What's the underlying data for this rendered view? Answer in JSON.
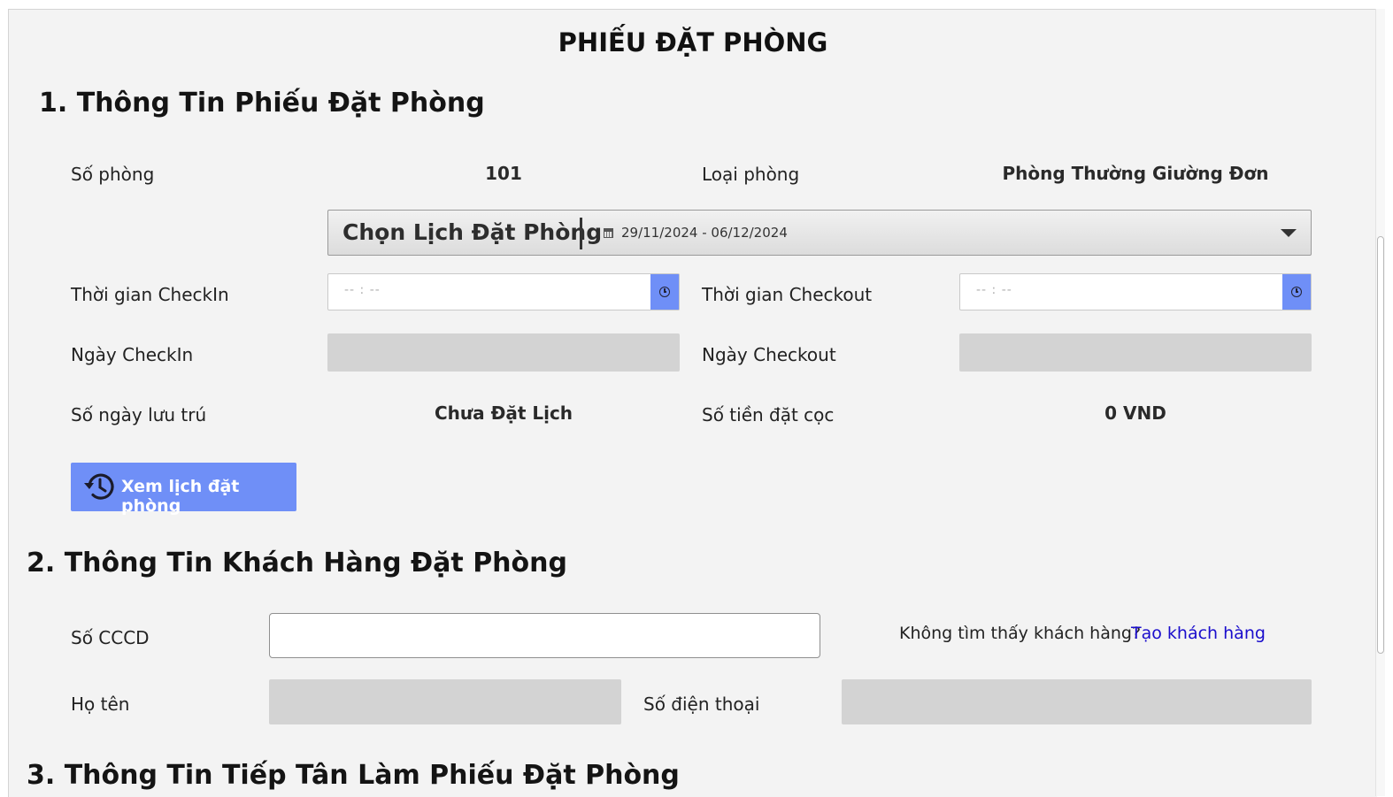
{
  "title": "PHIẾU ĐẶT PHÒNG",
  "section1": {
    "title": "1. Thông Tin Phiếu Đặt Phòng",
    "room_number_label": "Số phòng",
    "room_number_value": "101",
    "room_type_label": "Loại phòng",
    "room_type_value": "Phòng Thường Giường Đơn",
    "date_picker": {
      "button_label": "Chọn Lịch Đặt Phòng",
      "range": "29/11/2024 - 06/12/2024",
      "icon": "calendar-icon"
    },
    "checkin_time_label": "Thời gian CheckIn",
    "checkin_time_placeholder": "--  :  --",
    "checkout_time_label": "Thời gian Checkout",
    "checkout_time_placeholder": "--  :  --",
    "checkin_date_label": "Ngày CheckIn",
    "checkout_date_label": "Ngày Checkout",
    "stay_days_label": "Số ngày lưu trú",
    "stay_days_value": "Chưa Đặt Lịch",
    "deposit_label": "Số tiền đặt cọc",
    "deposit_value": "0 VND",
    "history_button": "Xem lịch đặt phòng"
  },
  "section2": {
    "title": "2. Thông Tin Khách Hàng Đặt Phòng",
    "id_label": "Số CCCD",
    "id_value": "",
    "not_found_text": "Không tìm thấy khách hàng?",
    "create_link": "Tạo khách hàng",
    "name_label": "Họ tên",
    "phone_label": "Số điện thoại"
  },
  "section3": {
    "title": "3. Thông Tin Tiếp Tân Làm Phiếu Đặt Phòng"
  },
  "colors": {
    "accent": "#6f8ff7",
    "link": "#1a0dcc",
    "background": "#f3f3f3",
    "disabled_field": "#d3d3d3"
  }
}
